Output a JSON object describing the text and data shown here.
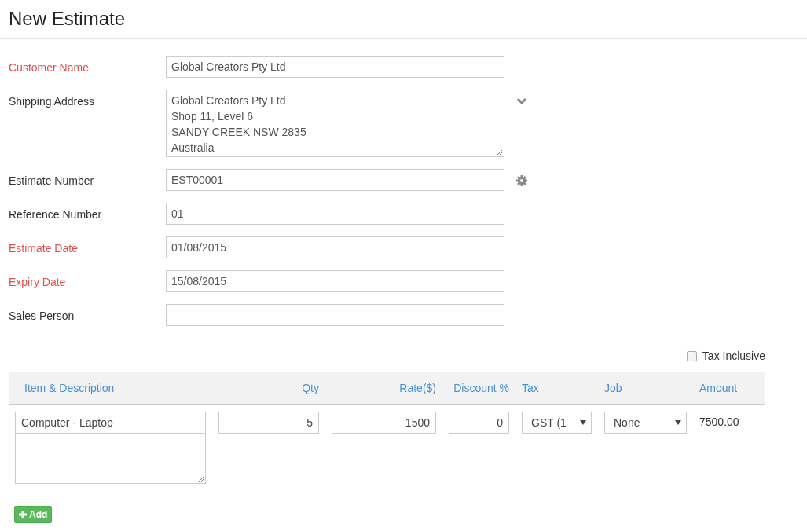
{
  "title": "New Estimate",
  "fields": [
    {
      "label": "Customer Name",
      "required": true,
      "kind": "input",
      "value": "Global Creators Pty Ltd"
    },
    {
      "label": "Shipping Address",
      "required": false,
      "kind": "address",
      "value": "Global Creators Pty Ltd\nShop 11, Level 6\nSANDY CREEK NSW 2835\nAustralia"
    },
    {
      "label": "Estimate Number",
      "required": false,
      "kind": "autonumber",
      "value": "EST00001"
    },
    {
      "label": "Reference Number",
      "required": false,
      "kind": "input",
      "value": "01"
    },
    {
      "label": "Estimate Date",
      "required": true,
      "kind": "input",
      "value": "01/08/2015"
    },
    {
      "label": "Expiry Date",
      "required": true,
      "kind": "input",
      "value": "15/08/2015"
    },
    {
      "label": "Sales Person",
      "required": false,
      "kind": "input"
    }
  ],
  "tax_inclusive": {
    "label": "Tax Inclusive",
    "checked": false
  },
  "table": {
    "columns": [
      "Item & Description",
      "Qty",
      "Rate($)",
      "Discount %",
      "Tax",
      "Job",
      "Amount"
    ],
    "rows": [
      {
        "item": "Computer - Laptop",
        "qty": "5",
        "rate": "1500",
        "discount": "0",
        "tax": "GST (1",
        "job": "None",
        "amount": "7500.00"
      }
    ]
  },
  "add_button": "Add"
}
